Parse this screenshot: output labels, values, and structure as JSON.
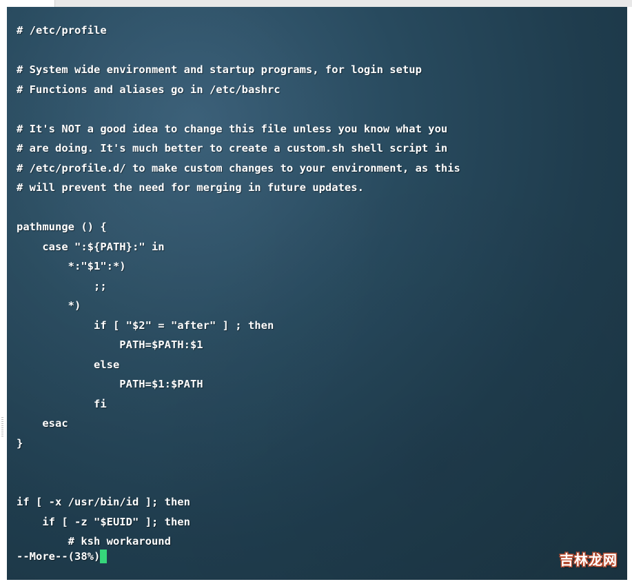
{
  "terminal": {
    "lines": [
      "# /etc/profile",
      "",
      "# System wide environment and startup programs, for login setup",
      "# Functions and aliases go in /etc/bashrc",
      "",
      "# It's NOT a good idea to change this file unless you know what you",
      "# are doing. It's much better to create a custom.sh shell script in",
      "# /etc/profile.d/ to make custom changes to your environment, as this",
      "# will prevent the need for merging in future updates.",
      "",
      "pathmunge () {",
      "    case \":${PATH}:\" in",
      "        *:\"$1\":*)",
      "            ;;",
      "        *)",
      "            if [ \"$2\" = \"after\" ] ; then",
      "                PATH=$PATH:$1",
      "            else",
      "                PATH=$1:$PATH",
      "            fi",
      "    esac",
      "}",
      "",
      "",
      "if [ -x /usr/bin/id ]; then",
      "    if [ -z \"$EUID\" ]; then",
      "        # ksh workaround"
    ],
    "status": "--More--(38%)"
  },
  "watermark": "吉林龙网"
}
